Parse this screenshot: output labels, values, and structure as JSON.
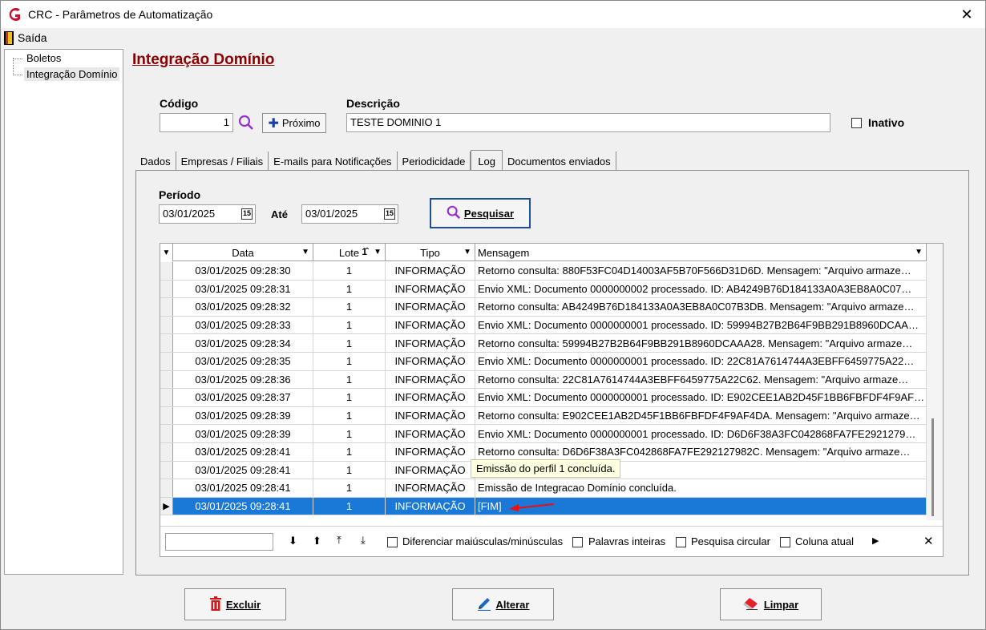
{
  "window": {
    "title": "CRC - Parâmetros de Automatização"
  },
  "menu": {
    "exit_label": "Saída"
  },
  "tree": {
    "items": [
      {
        "label": "Boletos"
      },
      {
        "label": "Integração Domínio"
      }
    ]
  },
  "page_title": "Integração Domínio",
  "form": {
    "codigo_label": "Código",
    "codigo_value": "1",
    "proximo_label": "Próximo",
    "descricao_label": "Descrição",
    "descricao_value": "TESTE DOMINIO 1",
    "inativo_label": "Inativo"
  },
  "tabs": [
    {
      "label": "Dados"
    },
    {
      "label": "Empresas / Filiais"
    },
    {
      "label": "E-mails para Notificações"
    },
    {
      "label": "Periodicidade"
    },
    {
      "label": "Log"
    },
    {
      "label": "Documentos enviados"
    }
  ],
  "log": {
    "periodo_label": "Período",
    "date_from": "03/01/2025",
    "ate_label": "Até",
    "date_to": "03/01/2025",
    "search_label": "Pesquisar",
    "columns": {
      "data": "Data",
      "lote": "Lote",
      "tipo": "Tipo",
      "mensagem": "Mensagem"
    },
    "rows": [
      {
        "data": "03/01/2025 09:28:30",
        "lote": "1",
        "tipo": "INFORMAÇÃO",
        "mensagem": "Retorno consulta: 880F53FC04D14003AF5B70F566D31D6D. Mensagem: \"Arquivo armaze…"
      },
      {
        "data": "03/01/2025 09:28:31",
        "lote": "1",
        "tipo": "INFORMAÇÃO",
        "mensagem": "Envio XML: Documento 0000000002 processado. ID: AB4249B76D184133A0A3EB8A0C07…"
      },
      {
        "data": "03/01/2025 09:28:32",
        "lote": "1",
        "tipo": "INFORMAÇÃO",
        "mensagem": "Retorno consulta: AB4249B76D184133A0A3EB8A0C07B3DB. Mensagem: \"Arquivo armaze…"
      },
      {
        "data": "03/01/2025 09:28:33",
        "lote": "1",
        "tipo": "INFORMAÇÃO",
        "mensagem": "Envio XML: Documento 0000000001 processado. ID: 59994B27B2B64F9BB291B8960DCAA…"
      },
      {
        "data": "03/01/2025 09:28:34",
        "lote": "1",
        "tipo": "INFORMAÇÃO",
        "mensagem": "Retorno consulta: 59994B27B2B64F9BB291B8960DCAAA28. Mensagem: \"Arquivo armaze…"
      },
      {
        "data": "03/01/2025 09:28:35",
        "lote": "1",
        "tipo": "INFORMAÇÃO",
        "mensagem": "Envio XML: Documento 0000000001 processado. ID: 22C81A7614744A3EBFF6459775A22…"
      },
      {
        "data": "03/01/2025 09:28:36",
        "lote": "1",
        "tipo": "INFORMAÇÃO",
        "mensagem": "Retorno consulta: 22C81A7614744A3EBFF6459775A22C62. Mensagem: \"Arquivo armaze…"
      },
      {
        "data": "03/01/2025 09:28:37",
        "lote": "1",
        "tipo": "INFORMAÇÃO",
        "mensagem": "Envio XML: Documento 0000000001 processado. ID: E902CEE1AB2D45F1BB6FBFDF4F9AF…"
      },
      {
        "data": "03/01/2025 09:28:39",
        "lote": "1",
        "tipo": "INFORMAÇÃO",
        "mensagem": "Retorno consulta: E902CEE1AB2D45F1BB6FBFDF4F9AF4DA. Mensagem: \"Arquivo armaze…"
      },
      {
        "data": "03/01/2025 09:28:39",
        "lote": "1",
        "tipo": "INFORMAÇÃO",
        "mensagem": "Envio XML: Documento 0000000001 processado. ID: D6D6F38A3FC042868FA7FE2921279…"
      },
      {
        "data": "03/01/2025 09:28:41",
        "lote": "1",
        "tipo": "INFORMAÇÃO",
        "mensagem": "Retorno consulta: D6D6F38A3FC042868FA7FE292127982C. Mensagem: \"Arquivo armaze…"
      },
      {
        "data": "03/01/2025 09:28:41",
        "lote": "1",
        "tipo": "INFORMAÇÃO",
        "mensagem": "Emissão do perfil 1 concluída."
      },
      {
        "data": "03/01/2025 09:28:41",
        "lote": "1",
        "tipo": "INFORMAÇÃO",
        "mensagem": "Emissão de Integracao Domínio concluída."
      },
      {
        "data": "03/01/2025 09:28:41",
        "lote": "1",
        "tipo": "INFORMAÇÃO",
        "mensagem": "[FIM]"
      }
    ],
    "tooltip": "Emissão do perfil 1 concluída.",
    "find": {
      "case_label": "Diferenciar maiúsculas/minúsculas",
      "whole_label": "Palavras inteiras",
      "circular_label": "Pesquisa circular",
      "column_label": "Coluna atual"
    }
  },
  "buttons": {
    "excluir": "Excluir",
    "alterar": "Alterar",
    "limpar": "Limpar"
  }
}
